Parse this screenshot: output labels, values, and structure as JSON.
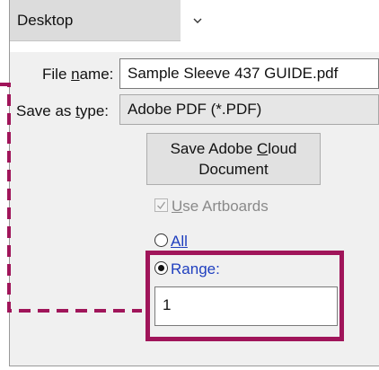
{
  "location": {
    "label": "Desktop"
  },
  "file_name": {
    "label_pre": "File ",
    "label_u": "n",
    "label_post": "ame:",
    "value": "Sample Sleeve 437 GUIDE.pdf"
  },
  "save_type": {
    "label_pre": "Save as ",
    "label_u": "t",
    "label_post": "ype:",
    "value": "Adobe PDF (*.PDF)"
  },
  "cloud_button": {
    "line1_pre": "Save Adobe ",
    "line1_u": "C",
    "line1_post": "loud",
    "line2": "Document"
  },
  "use_artboards": {
    "u": "U",
    "rest": "se Artboards",
    "checked": true,
    "disabled": true
  },
  "all_option": {
    "u": "A",
    "rest": "ll",
    "selected": false
  },
  "range_option": {
    "pre": "Ran",
    "u": "g",
    "post": "e:",
    "selected": true,
    "value": "1"
  },
  "colors": {
    "highlight": "#a0155a",
    "link": "#1f3fbf"
  },
  "icons": {
    "dropdown": "chevron-down-icon",
    "check": "check-icon"
  }
}
